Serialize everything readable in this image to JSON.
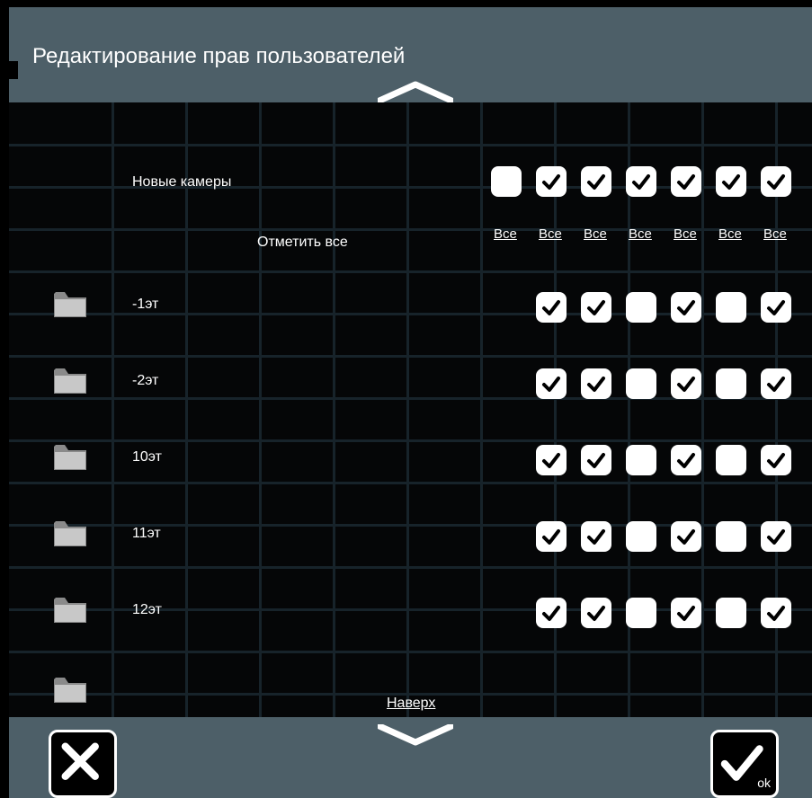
{
  "title": "Редактирование прав пользователей",
  "header_row": {
    "label": "Новые камеры",
    "checkboxes": [
      false,
      true,
      true,
      true,
      true,
      true,
      true
    ],
    "select_all_links": [
      "Все",
      "Все",
      "Все",
      "Все",
      "Все",
      "Все",
      "Все"
    ]
  },
  "mark_all_label": "Отметить все",
  "rows": [
    {
      "label": "-1эт",
      "checkboxes": [
        true,
        true,
        false,
        true,
        false,
        true
      ]
    },
    {
      "label": "-2эт",
      "checkboxes": [
        true,
        true,
        false,
        true,
        false,
        true
      ]
    },
    {
      "label": "10эт",
      "checkboxes": [
        true,
        true,
        false,
        true,
        false,
        true
      ]
    },
    {
      "label": "11эт",
      "checkboxes": [
        true,
        true,
        false,
        true,
        false,
        true
      ]
    },
    {
      "label": "12эт",
      "checkboxes": [
        true,
        true,
        false,
        true,
        false,
        true
      ]
    }
  ],
  "naverh_link": "Наверх",
  "icons": {
    "scroll_up": "chevron-up-icon",
    "scroll_down": "chevron-down-icon",
    "folder": "folder-icon",
    "close": "close-icon",
    "ok": "checkmark-icon"
  },
  "ok_label": "ok",
  "colors": {
    "panel": "#4d5f68",
    "background": "#050607",
    "grid": "#17232a",
    "checkbox": "#ffffff"
  }
}
